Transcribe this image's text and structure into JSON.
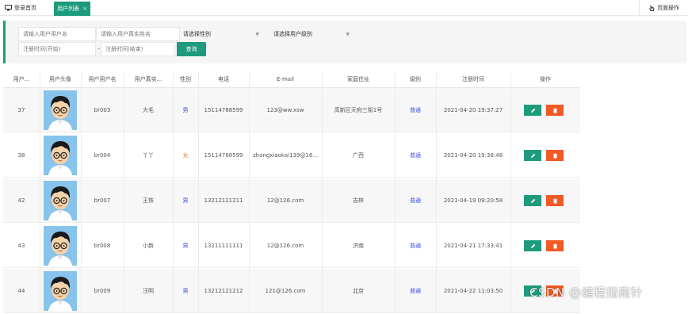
{
  "tabs": {
    "home_label": "登录首页",
    "active_label": "用户列表",
    "close_symbol": "×",
    "page_ops_label": "页面操作"
  },
  "filter": {
    "username_placeholder": "请输入用户用户名",
    "realname_placeholder": "请输入用户真实姓名",
    "gender_select": "请选择性别",
    "level_select": "请选择用户级别",
    "reg_start_placeholder": "注册时间(开始)",
    "separator": "-",
    "reg_end_placeholder": "注册时间(结束)",
    "query_label": "查询"
  },
  "table": {
    "headers": [
      "用户...",
      "用户头像",
      "用户用户名",
      "用户真实...",
      "性别",
      "电话",
      "E-mail",
      "家庭住址",
      "级别",
      "注册时间",
      "操作"
    ],
    "rows": [
      {
        "id": "37",
        "username": "br003",
        "realname": "大毛",
        "gender": "男",
        "phone": "15114788599",
        "email": "123@ww.xsw",
        "address": "高新区天府三街1号",
        "level": "普通",
        "reg_time": "2021-04-20 19:37:27"
      },
      {
        "id": "38",
        "username": "br004",
        "realname": "丫丫",
        "gender": "女",
        "phone": "15114788599",
        "email": "zhangxiaokai139@16...",
        "address": "广西",
        "level": "普通",
        "reg_time": "2021-04-20 19:38:48"
      },
      {
        "id": "42",
        "username": "br007",
        "realname": "王铁",
        "gender": "男",
        "phone": "13212121211",
        "email": "12@126.com",
        "address": "吉林",
        "level": "普通",
        "reg_time": "2021-04-19 09:20:58"
      },
      {
        "id": "43",
        "username": "br008",
        "realname": "小新",
        "gender": "男",
        "phone": "13211111111",
        "email": "12@126.com",
        "address": "济南",
        "level": "普通",
        "reg_time": "2021-04-21 17:33:41"
      },
      {
        "id": "44",
        "username": "br009",
        "realname": "汪明",
        "gender": "男",
        "phone": "13212121212",
        "email": "121@126.com",
        "address": "北京",
        "level": "普通",
        "reg_time": "2021-04-22 11:03:50"
      }
    ],
    "edit_icon": "pencil-icon",
    "delete_icon": "trash-icon"
  },
  "watermark": "CSDN @编程指南针",
  "colors": {
    "primary": "#1e9b7c",
    "danger": "#f15a24",
    "male": "#3b4fe0",
    "female": "#e0742b"
  }
}
